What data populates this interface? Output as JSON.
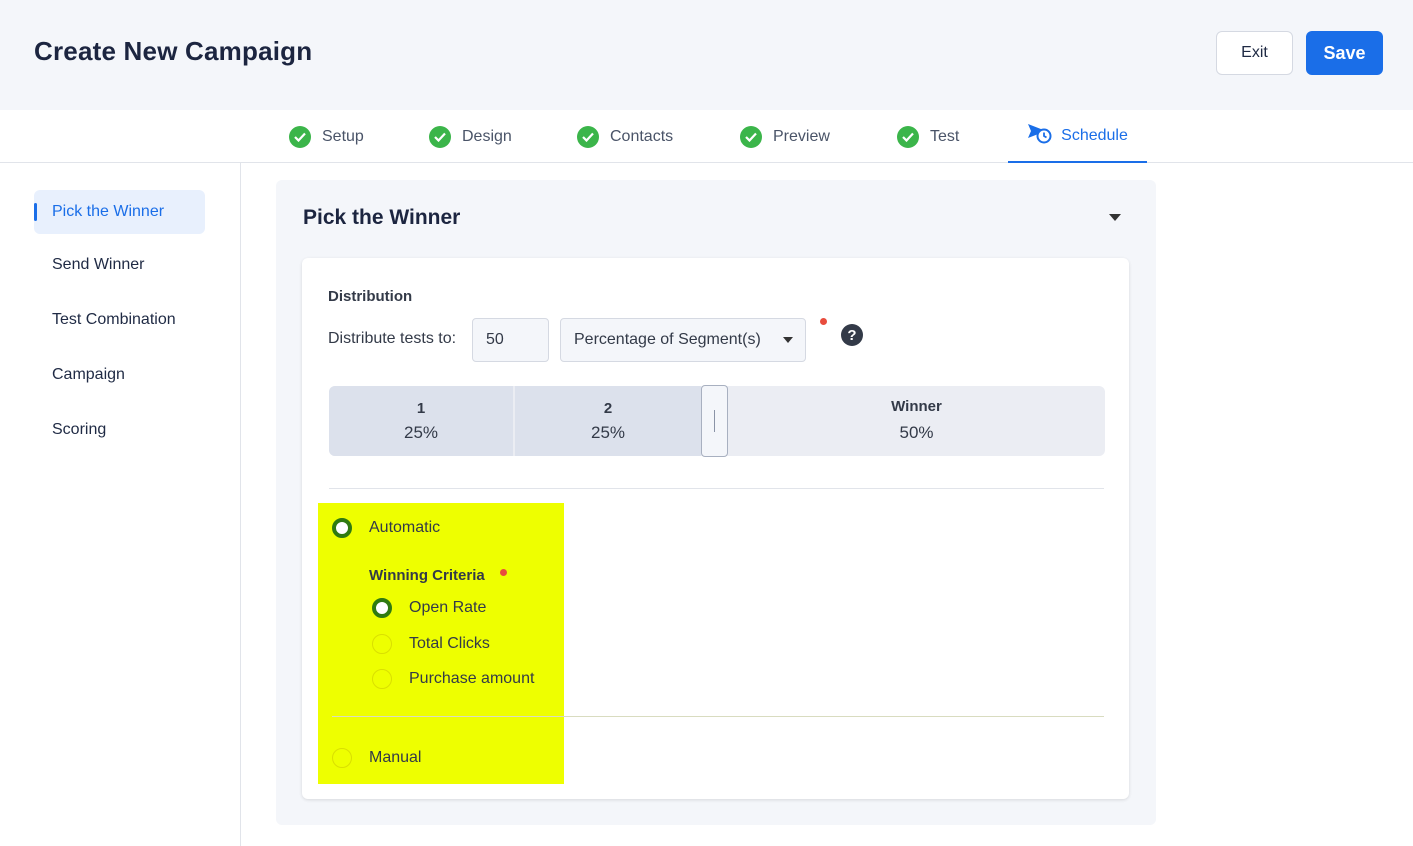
{
  "header": {
    "title": "Create New Campaign",
    "exit_label": "Exit",
    "save_label": "Save"
  },
  "steps": [
    {
      "label": "Setup",
      "status": "complete"
    },
    {
      "label": "Design",
      "status": "complete"
    },
    {
      "label": "Contacts",
      "status": "complete"
    },
    {
      "label": "Preview",
      "status": "complete"
    },
    {
      "label": "Test",
      "status": "complete"
    },
    {
      "label": "Schedule",
      "status": "active"
    }
  ],
  "sidebar": {
    "items": [
      {
        "label": "Pick the Winner",
        "active": true
      },
      {
        "label": "Send Winner"
      },
      {
        "label": "Test Combination"
      },
      {
        "label": "Campaign"
      },
      {
        "label": "Scoring"
      }
    ]
  },
  "panel": {
    "title": "Pick the Winner",
    "distribution": {
      "heading": "Distribution",
      "label": "Distribute tests to:",
      "value": "50",
      "unit_selected": "Percentage of Segment(s)"
    },
    "segments": [
      {
        "name": "1",
        "percent": "25%"
      },
      {
        "name": "2",
        "percent": "25%"
      },
      {
        "name": "Winner",
        "percent": "50%"
      }
    ],
    "modes": {
      "automatic_label": "Automatic",
      "manual_label": "Manual",
      "selected": "automatic"
    },
    "criteria": {
      "heading": "Winning Criteria",
      "options": [
        "Open Rate",
        "Total Clicks",
        "Purchase amount"
      ],
      "selected": "Open Rate"
    }
  },
  "colors": {
    "accent": "#1a6ee8",
    "success": "#3bb54a",
    "required": "#e84c3d",
    "highlight": "#eeff00",
    "radio_selected": "#2f7a10"
  }
}
